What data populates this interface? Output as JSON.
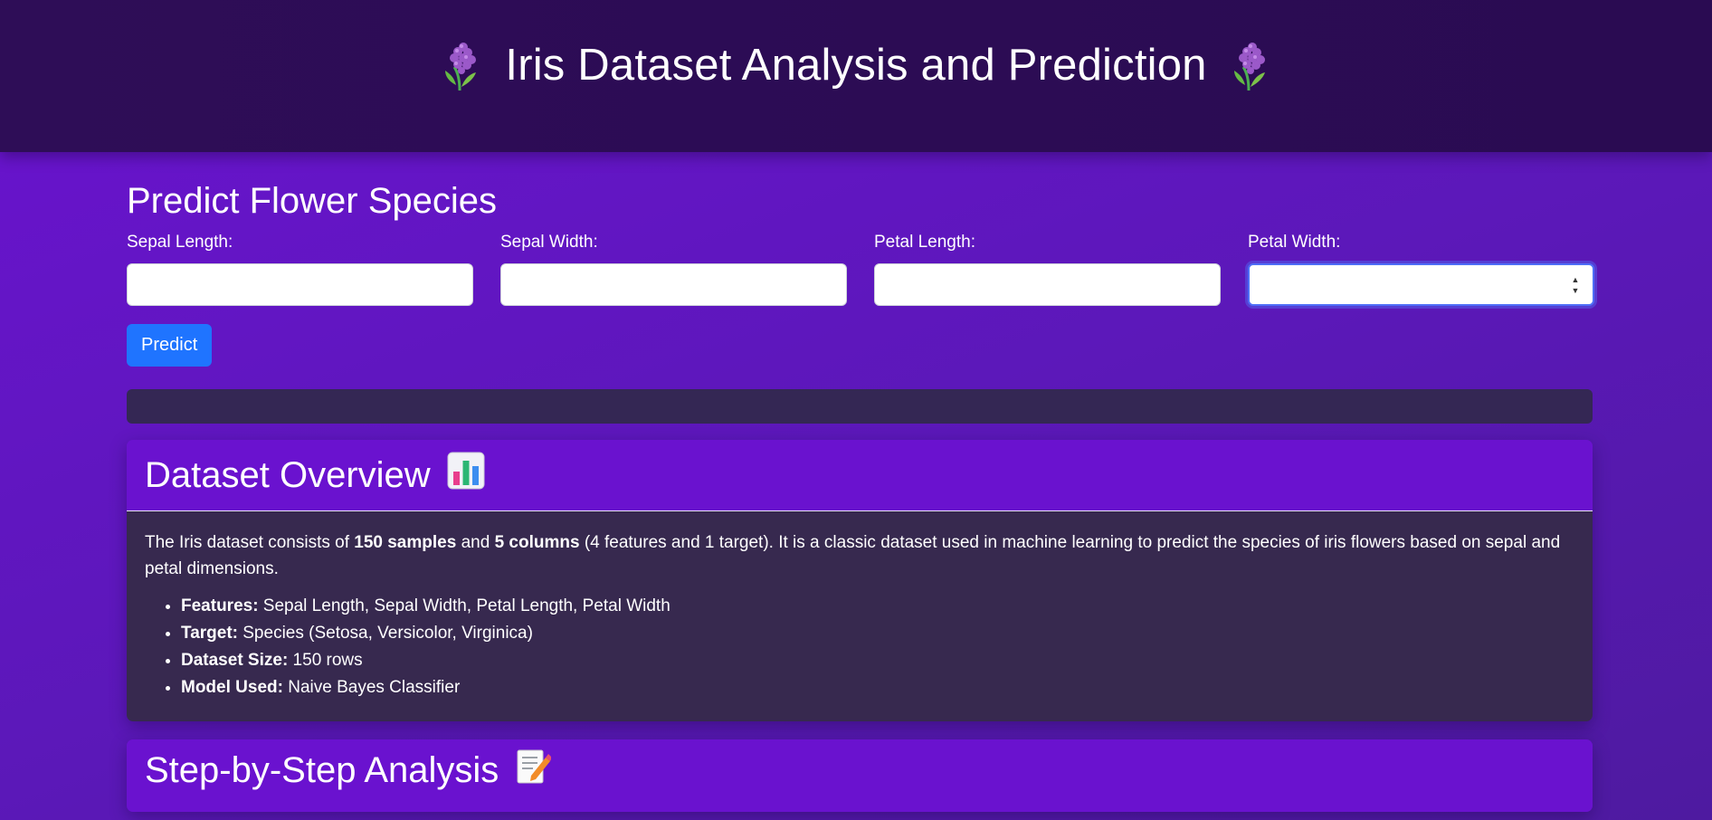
{
  "header": {
    "title": "Iris Dataset Analysis and Prediction",
    "icon_left": "hyacinth-flower-icon",
    "icon_right": "hyacinth-flower-icon"
  },
  "predict_form": {
    "title": "Predict Flower Species",
    "fields": [
      {
        "label": "Sepal Length:",
        "value": ""
      },
      {
        "label": "Sepal Width:",
        "value": ""
      },
      {
        "label": "Petal Length:",
        "value": ""
      },
      {
        "label": "Petal Width:",
        "value": ""
      }
    ],
    "button_label": "Predict",
    "result_text": ""
  },
  "overview": {
    "title": "Dataset Overview",
    "icon": "bar-chart-icon",
    "intro_1": "The Iris dataset consists of ",
    "samples": "150 samples",
    "and": " and ",
    "columns": "5 columns",
    "intro_2": " (4 features and 1 target). It is a classic dataset used in machine learning to predict the species of iris flowers based on sepal and petal dimensions.",
    "items": [
      {
        "key": "Features:",
        "value": " Sepal Length, Sepal Width, Petal Length, Petal Width"
      },
      {
        "key": "Target:",
        "value": " Species (Setosa, Versicolor, Virginica)"
      },
      {
        "key": "Dataset Size:",
        "value": " 150 rows"
      },
      {
        "key": "Model Used:",
        "value": " Naive Bayes Classifier"
      }
    ]
  },
  "analysis": {
    "title": "Step-by-Step Analysis",
    "icon": "memo-pencil-icon"
  },
  "colors": {
    "header_bg": "#2e0d57",
    "page_bg": "#6a13cf",
    "card_header_bg": "#6a12cf",
    "card_body_bg": "#37294f",
    "button_bg": "#1f74ff"
  }
}
